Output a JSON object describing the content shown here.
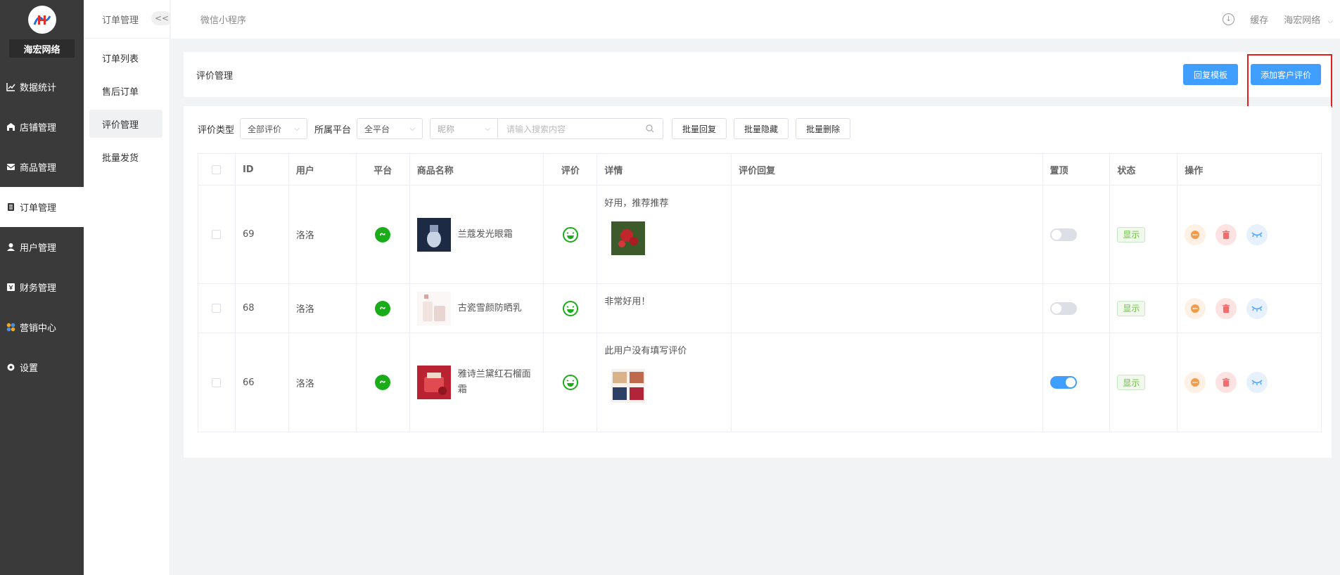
{
  "brand": {
    "name": "海宏网络"
  },
  "sidebar": {
    "items": [
      {
        "label": "数据统计",
        "icon": "chart-icon",
        "active": false
      },
      {
        "label": "店铺管理",
        "icon": "store-icon",
        "active": false
      },
      {
        "label": "商品管理",
        "icon": "product-icon",
        "active": false
      },
      {
        "label": "订单管理",
        "icon": "order-icon",
        "active": true
      },
      {
        "label": "用户管理",
        "icon": "user-icon",
        "active": false
      },
      {
        "label": "财务管理",
        "icon": "finance-icon",
        "active": false
      },
      {
        "label": "营销中心",
        "icon": "marketing-icon",
        "active": false
      },
      {
        "label": "设置",
        "icon": "settings-icon",
        "active": false
      }
    ]
  },
  "submenu": {
    "title": "订单管理",
    "collapse": "<<",
    "items": [
      {
        "label": "订单列表",
        "active": false
      },
      {
        "label": "售后订单",
        "active": false
      },
      {
        "label": "评价管理",
        "active": true
      },
      {
        "label": "批量发货",
        "active": false
      }
    ]
  },
  "topbar": {
    "tab": "微信小程序",
    "cache": "缓存",
    "user": "海宏网络"
  },
  "title_card": {
    "title": "评价管理",
    "reply_template": "回复模板",
    "add_review": "添加客户评价"
  },
  "filters": {
    "type_label": "评价类型",
    "type_value": "全部评价",
    "platform_label": "所属平台",
    "platform_value": "全平台",
    "search_field": "昵称",
    "search_placeholder": "请输入搜索内容",
    "batch_reply": "批量回复",
    "batch_hide": "批量隐藏",
    "batch_delete": "批量删除"
  },
  "table": {
    "headers": {
      "id": "ID",
      "user": "用户",
      "platform": "平台",
      "product": "商品名称",
      "rating": "评价",
      "detail": "详情",
      "reply": "评价回复",
      "top": "置顶",
      "status": "状态",
      "ops": "操作"
    },
    "rows": [
      {
        "id": "69",
        "user": "洛洛",
        "product": "兰蔻发光眼霜",
        "detail": "好用，推荐推荐",
        "pinned": false,
        "status": "显示"
      },
      {
        "id": "68",
        "user": "洛洛",
        "product": "古瓷雪颜防晒乳",
        "detail": "非常好用！",
        "pinned": false,
        "status": "显示"
      },
      {
        "id": "66",
        "user": "洛洛",
        "product": "雅诗兰黛红石榴面霜",
        "detail": "此用户没有填写评价",
        "pinned": true,
        "status": "显示"
      }
    ]
  },
  "colors": {
    "primary": "#409eff",
    "sidebar": "#3a3a3a",
    "highlight": "#e02020",
    "success": "#67c23a",
    "wechat": "#1aad19"
  }
}
